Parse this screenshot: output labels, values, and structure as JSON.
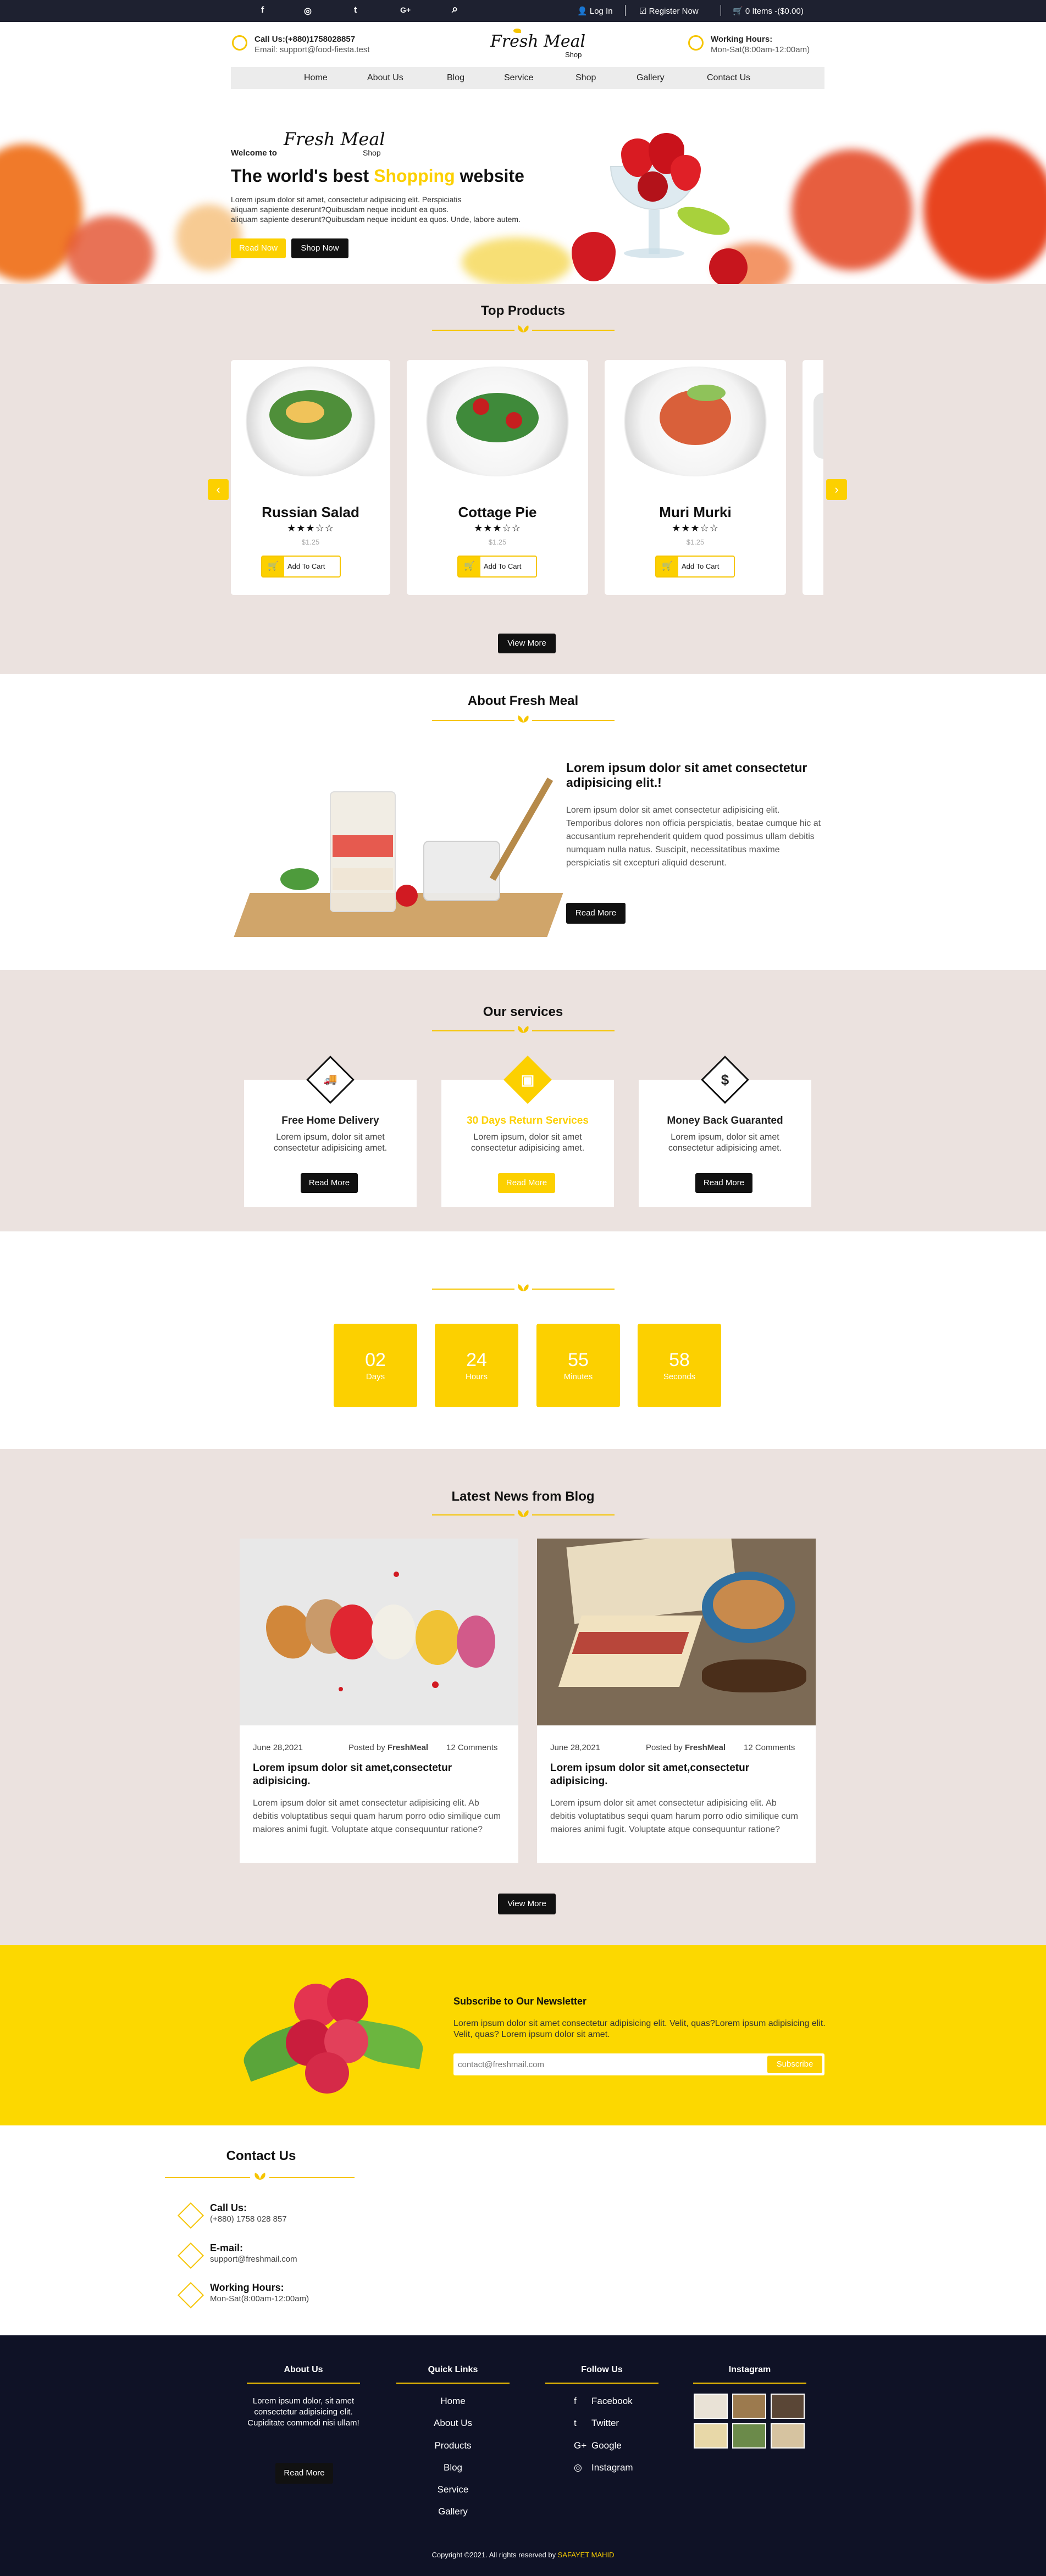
{
  "topbar": {
    "facebook_icon": "f",
    "instagram_icon": "◎",
    "twitter_icon": "t",
    "google_icon": "G+",
    "search_icon": "⌕",
    "login": "Log In",
    "register": "Register Now",
    "cart": "0 Items -($0.00)"
  },
  "header": {
    "call_title": "Call Us:(+880)1758028857",
    "call_sub": "Email: support@food-fiesta.test",
    "logo_main": "Fresh Meal",
    "logo_sub": "Shop",
    "hours_title": "Working Hours:",
    "hours_sub": "Mon-Sat(8:00am-12:00am)"
  },
  "nav": {
    "items": [
      "Home",
      "About Us",
      "Blog",
      "Service",
      "Shop",
      "Gallery",
      "Contact Us"
    ]
  },
  "hero": {
    "welcome": "Welcome to",
    "logo_main": "Fresh Meal",
    "logo_sub": "Shop",
    "heading_pre": "The world's best ",
    "heading_highlight": "Shopping",
    "heading_post": " website",
    "desc1": "Lorem ipsum dolor sit amet, consectetur adipisicing elit. Perspiciatis",
    "desc2": "aliquam sapiente deserunt?Quibusdam neque incidunt ea quos.",
    "desc3": "aliquam sapiente deserunt?Quibusdam neque incidunt ea quos. Unde, labore autem.",
    "read_now": "Read Now",
    "shop_now": "Shop Now"
  },
  "top_products": {
    "title": "Top Products",
    "prev_icon": "‹",
    "next_icon": "›",
    "items": [
      {
        "name": "Russian Salad",
        "stars": "★★★☆☆",
        "price": "$1.25",
        "cart": "Add To Cart"
      },
      {
        "name": "Cottage Pie",
        "stars": "★★★☆☆",
        "price": "$1.25",
        "cart": "Add To Cart"
      },
      {
        "name": "Muri Murki",
        "stars": "★★★☆☆",
        "price": "$1.25",
        "cart": "Add To Cart"
      }
    ],
    "view_more": "View More"
  },
  "about": {
    "title": "About Fresh Meal",
    "heading": "Lorem ipsum dolor sit amet consectetur adipisicing elit.!",
    "body": "Lorem ipsum dolor sit amet consectetur adipisicing elit. Temporibus dolores non officia perspiciatis, beatae cumque hic at accusantium reprehenderit quidem quod possimus ullam debitis numquam nulla natus. Suscipit, necessitatibus maxime perspiciatis sit excepturi aliquid deserunt.",
    "button": "Read More"
  },
  "services": {
    "title": "Our services",
    "items": [
      {
        "icon": "🚚",
        "title": "Free Home Delivery",
        "desc": "Lorem ipsum, dolor sit amet consectetur adipisicing amet.",
        "button": "Read More"
      },
      {
        "icon": "▣",
        "title": "30 Days Return Services",
        "desc": "Lorem ipsum, dolor sit amet consectetur adipisicing amet.",
        "button": "Read More"
      },
      {
        "icon": "$",
        "title": "Money Back Guaranted",
        "desc": "Lorem ipsum, dolor sit amet consectetur adipisicing amet.",
        "button": "Read More"
      }
    ]
  },
  "countdown": {
    "items": [
      {
        "value": "02",
        "label": "Days"
      },
      {
        "value": "24",
        "label": "Hours"
      },
      {
        "value": "55",
        "label": "Minutes"
      },
      {
        "value": "58",
        "label": "Seconds"
      }
    ]
  },
  "blog": {
    "title": "Latest News from Blog",
    "posts": [
      {
        "date": "June 28,2021",
        "posted_by": "Posted by",
        "author": "FreshMeal",
        "comments": "12 Comments",
        "title": "Lorem ipsum dolor sit amet,consectetur adipisicing.",
        "desc": "Lorem ipsum dolor sit amet consectetur adipisicing elit. Ab debitis voluptatibus sequi quam harum porro odio similique cum maiores animi fugit. Voluptate atque consequuntur ratione?"
      },
      {
        "date": "June 28,2021",
        "posted_by": "Posted by",
        "author": "FreshMeal",
        "comments": "12 Comments",
        "title": "Lorem ipsum dolor sit amet,consectetur adipisicing.",
        "desc": "Lorem ipsum dolor sit amet consectetur adipisicing elit. Ab debitis voluptatibus sequi quam harum porro odio similique cum maiores animi fugit. Voluptate atque consequuntur ratione?"
      }
    ],
    "view_more": "View More"
  },
  "newsletter": {
    "title": "Subscribe to Our Newsletter",
    "desc": "Lorem ipsum dolor sit amet consectetur adipisicing elit. Velit, quas?Lorem ipsum adipisicing elit. Velit, quas? Lorem ipsum dolor sit amet.",
    "placeholder": "contact@freshmail.com",
    "button": "Subscribe"
  },
  "contact": {
    "title": "Contact Us",
    "items": [
      {
        "label": "Call Us:",
        "value": "(+880) 1758 028 857"
      },
      {
        "label": "E-mail:",
        "value": "support@freshmail.com"
      },
      {
        "label": "Working Hours:",
        "value": "Mon-Sat(8:00am-12:00am)"
      }
    ]
  },
  "footer": {
    "about_title": "About Us",
    "about_text": "Lorem ipsum dolor, sit amet consectetur adipisicing elit. Cupiditate commodi nisi ullam!",
    "about_button": "Read More",
    "links_title": "Quick Links",
    "links": [
      "Home",
      "About Us",
      "Products",
      "Blog",
      "Service",
      "Gallery"
    ],
    "follow_title": "Follow Us",
    "follow": [
      {
        "icon": "f",
        "label": "Facebook"
      },
      {
        "icon": "t",
        "label": "Twitter"
      },
      {
        "icon": "G+",
        "label": "Google"
      },
      {
        "icon": "◎",
        "label": "Instagram"
      }
    ],
    "instagram_title": "Instagram",
    "copyright": "Copyright ©2021. All rights reserved by",
    "author": "SAFAYET MAHID"
  },
  "colors": {
    "accent": "#fcd000",
    "dark": "#1e2130",
    "section_bg": "#ebe2df",
    "footer_bg": "#0f1226"
  }
}
